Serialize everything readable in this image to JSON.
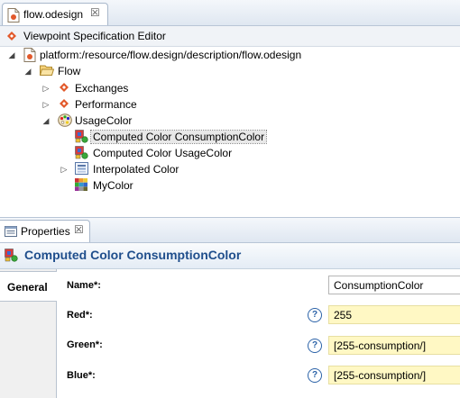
{
  "editor_tab": {
    "title": "flow.odesign",
    "close": "☒"
  },
  "editor_header": {
    "title": "Viewpoint Specification Editor"
  },
  "tree": {
    "root": "platform:/resource/flow.design/description/flow.odesign",
    "viewpoint": "Flow",
    "items": {
      "exchanges": "Exchanges",
      "performance": "Performance",
      "usagecolor": "UsageColor",
      "computed_consumption": "Computed Color ConsumptionColor",
      "computed_usage": "Computed Color UsageColor",
      "interpolated": "Interpolated Color",
      "mycolor": "MyColor"
    }
  },
  "properties_tab": {
    "title": "Properties",
    "close": "☒"
  },
  "properties_title": "Computed Color ConsumptionColor",
  "section_tabs": [
    "General"
  ],
  "fields": {
    "name": {
      "label": "Name*:",
      "value": "ConsumptionColor"
    },
    "red": {
      "label": "Red*:",
      "value": "255"
    },
    "green": {
      "label": "Green*:",
      "value": "[255-consumption/]"
    },
    "blue": {
      "label": "Blue*:",
      "value": "[255-consumption/]"
    }
  },
  "help_glyph": "?",
  "colors": {
    "sirius_orange": "#e2592b",
    "title_blue": "#1f4e8c",
    "field_yellow": "#fff8c4",
    "help_blue": "#2c63a8"
  }
}
